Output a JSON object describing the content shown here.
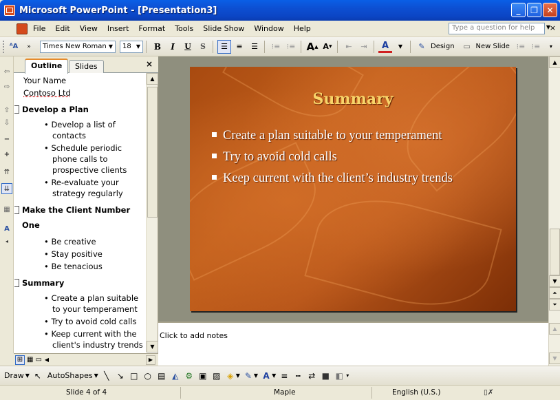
{
  "window": {
    "title": "Microsoft PowerPoint - [Presentation3]",
    "minimize": "_",
    "restore": "❐",
    "close": "✕"
  },
  "menu": {
    "items": [
      "File",
      "Edit",
      "View",
      "Insert",
      "Format",
      "Tools",
      "Slide Show",
      "Window",
      "Help"
    ],
    "ask_placeholder": "Type a question for help",
    "close": "×"
  },
  "format_toolbar": {
    "font_name": "Times New Roman",
    "font_size": "18",
    "bold": "B",
    "italic": "I",
    "underline": "U",
    "shadow": "S",
    "font_color": "A",
    "design": "Design",
    "new_slide": "New Slide"
  },
  "outline": {
    "tab_outline": "Outline",
    "tab_slides": "Slides",
    "close": "×",
    "lines": [
      {
        "text": "Your Name",
        "kind": "text"
      },
      {
        "text": "Contoso Ltd",
        "kind": "text"
      },
      {
        "text": "Develop a Plan",
        "kind": "title"
      },
      {
        "text": "• Develop a list of",
        "kind": "bullet"
      },
      {
        "text": "contacts",
        "kind": "cont"
      },
      {
        "text": "• Schedule periodic",
        "kind": "bullet"
      },
      {
        "text": "phone calls to",
        "kind": "cont"
      },
      {
        "text": "prospective clients",
        "kind": "cont"
      },
      {
        "text": "• Re-evaluate your",
        "kind": "bullet"
      },
      {
        "text": "strategy regularly",
        "kind": "cont"
      },
      {
        "text": "Make the Client Number",
        "kind": "title"
      },
      {
        "text": "One",
        "kind": "titlecont"
      },
      {
        "text": "• Be creative",
        "kind": "bullet"
      },
      {
        "text": "• Stay positive",
        "kind": "bullet"
      },
      {
        "text": "• Be tenacious",
        "kind": "bullet"
      },
      {
        "text": "Summary",
        "kind": "title"
      },
      {
        "text": "• Create a plan suitable",
        "kind": "bullet"
      },
      {
        "text": "to your temperament",
        "kind": "cont"
      },
      {
        "text": "• Try to avoid cold calls",
        "kind": "bullet"
      },
      {
        "text": "• Keep current with the",
        "kind": "bullet"
      },
      {
        "text": "client's industry trends",
        "kind": "cont"
      }
    ]
  },
  "slide": {
    "title": "Summary",
    "bullets": [
      "Create a plan suitable to your temperament",
      "Try to avoid cold calls",
      "Keep current with the client’s industry trends"
    ]
  },
  "notes": {
    "placeholder": "Click to add notes"
  },
  "draw_toolbar": {
    "draw": "Draw",
    "autoshapes": "AutoShapes"
  },
  "status": {
    "slide": "Slide 4 of 4",
    "design": "Maple",
    "language": "English (U.S.)"
  },
  "colors": {
    "title_bar": "#0b45c4",
    "slide_bg": "#b8561a",
    "slide_title": "#f8d56a"
  }
}
